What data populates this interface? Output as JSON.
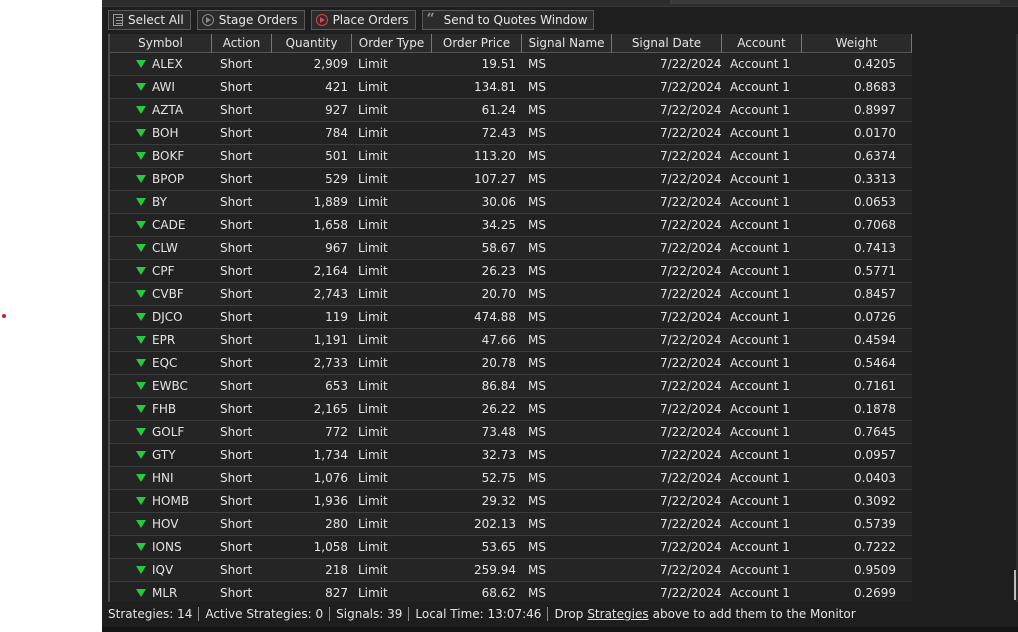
{
  "toolbar": {
    "select_all": "Select All",
    "stage_orders": "Stage Orders",
    "place_orders": "Place Orders",
    "send_to_quotes": "Send to Quotes Window"
  },
  "columns": [
    "Symbol",
    "Action",
    "Quantity",
    "Order Type",
    "Order Price",
    "Signal Name",
    "Signal Date",
    "Account",
    "Weight"
  ],
  "rows": [
    [
      "ALEX",
      "Short",
      "2,909",
      "Limit",
      "19.51",
      "MS",
      "7/22/2024",
      "Account 1",
      "0.4205"
    ],
    [
      "AWI",
      "Short",
      "421",
      "Limit",
      "134.81",
      "MS",
      "7/22/2024",
      "Account 1",
      "0.8683"
    ],
    [
      "AZTA",
      "Short",
      "927",
      "Limit",
      "61.24",
      "MS",
      "7/22/2024",
      "Account 1",
      "0.8997"
    ],
    [
      "BOH",
      "Short",
      "784",
      "Limit",
      "72.43",
      "MS",
      "7/22/2024",
      "Account 1",
      "0.0170"
    ],
    [
      "BOKF",
      "Short",
      "501",
      "Limit",
      "113.20",
      "MS",
      "7/22/2024",
      "Account 1",
      "0.6374"
    ],
    [
      "BPOP",
      "Short",
      "529",
      "Limit",
      "107.27",
      "MS",
      "7/22/2024",
      "Account 1",
      "0.3313"
    ],
    [
      "BY",
      "Short",
      "1,889",
      "Limit",
      "30.06",
      "MS",
      "7/22/2024",
      "Account 1",
      "0.0653"
    ],
    [
      "CADE",
      "Short",
      "1,658",
      "Limit",
      "34.25",
      "MS",
      "7/22/2024",
      "Account 1",
      "0.7068"
    ],
    [
      "CLW",
      "Short",
      "967",
      "Limit",
      "58.67",
      "MS",
      "7/22/2024",
      "Account 1",
      "0.7413"
    ],
    [
      "CPF",
      "Short",
      "2,164",
      "Limit",
      "26.23",
      "MS",
      "7/22/2024",
      "Account 1",
      "0.5771"
    ],
    [
      "CVBF",
      "Short",
      "2,743",
      "Limit",
      "20.70",
      "MS",
      "7/22/2024",
      "Account 1",
      "0.8457"
    ],
    [
      "DJCO",
      "Short",
      "119",
      "Limit",
      "474.88",
      "MS",
      "7/22/2024",
      "Account 1",
      "0.0726"
    ],
    [
      "EPR",
      "Short",
      "1,191",
      "Limit",
      "47.66",
      "MS",
      "7/22/2024",
      "Account 1",
      "0.4594"
    ],
    [
      "EQC",
      "Short",
      "2,733",
      "Limit",
      "20.78",
      "MS",
      "7/22/2024",
      "Account 1",
      "0.5464"
    ],
    [
      "EWBC",
      "Short",
      "653",
      "Limit",
      "86.84",
      "MS",
      "7/22/2024",
      "Account 1",
      "0.7161"
    ],
    [
      "FHB",
      "Short",
      "2,165",
      "Limit",
      "26.22",
      "MS",
      "7/22/2024",
      "Account 1",
      "0.1878"
    ],
    [
      "GOLF",
      "Short",
      "772",
      "Limit",
      "73.48",
      "MS",
      "7/22/2024",
      "Account 1",
      "0.7645"
    ],
    [
      "GTY",
      "Short",
      "1,734",
      "Limit",
      "32.73",
      "MS",
      "7/22/2024",
      "Account 1",
      "0.0957"
    ],
    [
      "HNI",
      "Short",
      "1,076",
      "Limit",
      "52.75",
      "MS",
      "7/22/2024",
      "Account 1",
      "0.0403"
    ],
    [
      "HOMB",
      "Short",
      "1,936",
      "Limit",
      "29.32",
      "MS",
      "7/22/2024",
      "Account 1",
      "0.3092"
    ],
    [
      "HOV",
      "Short",
      "280",
      "Limit",
      "202.13",
      "MS",
      "7/22/2024",
      "Account 1",
      "0.5739"
    ],
    [
      "IONS",
      "Short",
      "1,058",
      "Limit",
      "53.65",
      "MS",
      "7/22/2024",
      "Account 1",
      "0.7222"
    ],
    [
      "IQV",
      "Short",
      "218",
      "Limit",
      "259.94",
      "MS",
      "7/22/2024",
      "Account 1",
      "0.9509"
    ],
    [
      "MLR",
      "Short",
      "827",
      "Limit",
      "68.62",
      "MS",
      "7/22/2024",
      "Account 1",
      "0.2699"
    ]
  ],
  "status": {
    "strategies": "Strategies: 14",
    "active_strategies": "Active Strategies: 0",
    "signals": "Signals: 39",
    "local_time": "Local Time: 13:07:46",
    "drop_prefix": "Drop",
    "drop_link": "Strategies",
    "drop_suffix": "above to add them to the Monitor"
  },
  "colors": {
    "accent_green": "#27c93f",
    "place_red": "#e0434f",
    "background": "#1e1e1e"
  },
  "icons": {
    "direction": "down-arrow-icon",
    "select_all": "list-icon",
    "stage": "play-circle-icon",
    "place": "play-circle-red-icon",
    "quotes": "quote-icon"
  }
}
